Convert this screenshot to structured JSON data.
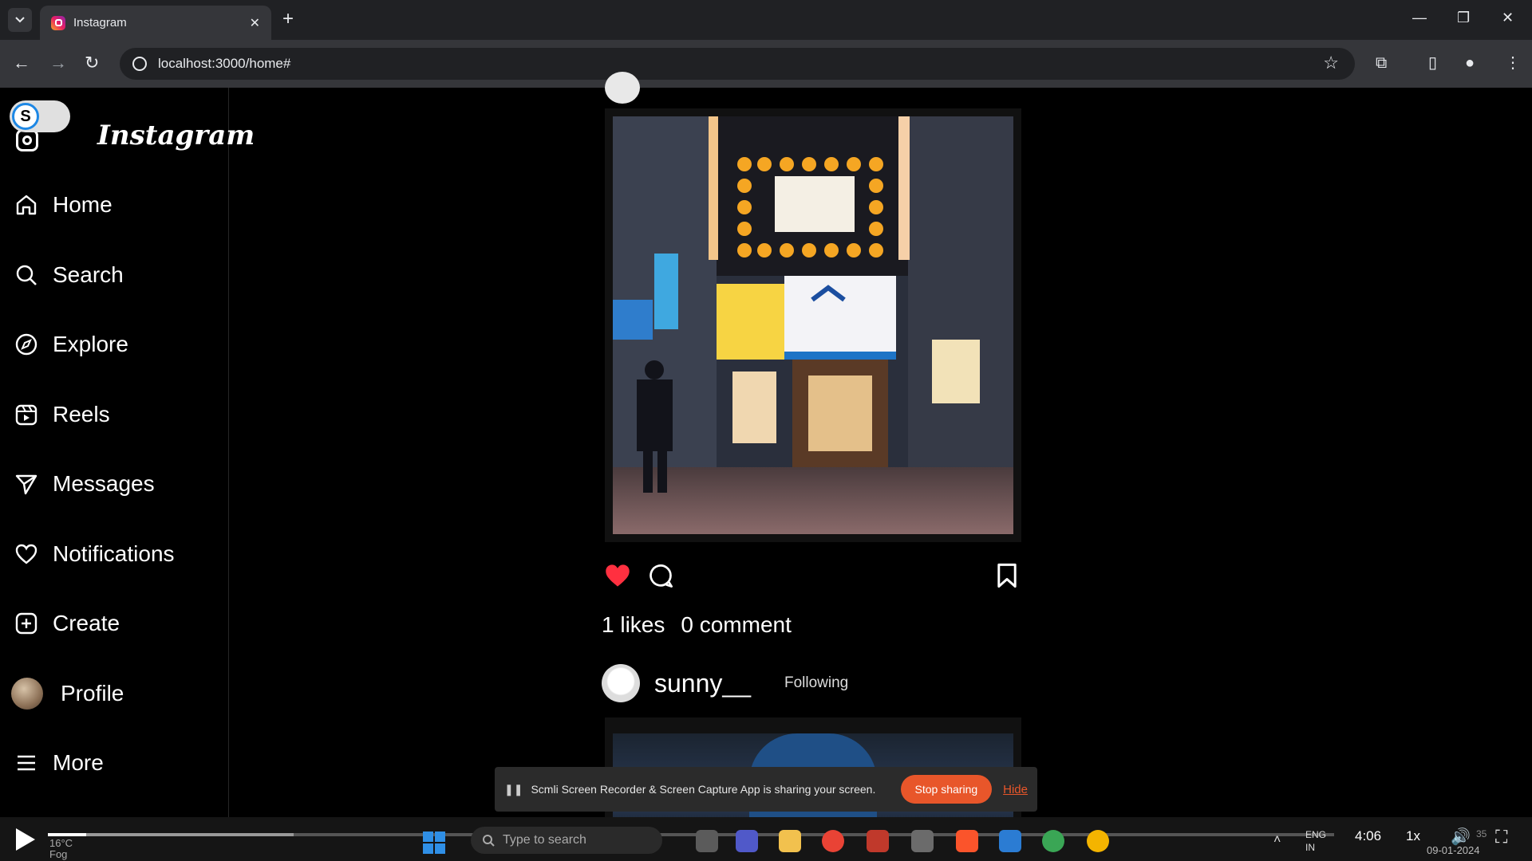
{
  "browser": {
    "tab_title": "Instagram",
    "url": "localhost:3000/home#",
    "new_tab_icon": "plus-icon",
    "close_tab_icon": "close-icon"
  },
  "sidebar": {
    "toggle_letter": "S",
    "logo_text": "Instagram",
    "items": [
      {
        "label": "Home",
        "icon": "home-icon"
      },
      {
        "label": "Search",
        "icon": "search-icon"
      },
      {
        "label": "Explore",
        "icon": "compass-icon"
      },
      {
        "label": "Reels",
        "icon": "reels-icon"
      },
      {
        "label": "Messages",
        "icon": "send-icon"
      },
      {
        "label": "Notifications",
        "icon": "heart-icon"
      },
      {
        "label": "Create",
        "icon": "plus-square-icon"
      },
      {
        "label": "Profile",
        "icon": "avatar"
      },
      {
        "label": "More",
        "icon": "menu-icon"
      }
    ]
  },
  "post": {
    "liked": true,
    "likes_text": "1 likes",
    "comments_text": "0 comment",
    "like_color": "#ff3040"
  },
  "next_post": {
    "username": "sunny__",
    "follow_status": "Following"
  },
  "share_banner": {
    "message": "Scmli Screen Recorder & Screen Capture App is sharing your screen.",
    "stop_label": "Stop sharing",
    "hide_label": "Hide",
    "accent": "#e8562a"
  },
  "player": {
    "weather_temp": "16°C",
    "weather_desc": "Fog",
    "search_placeholder": "Type to search",
    "time_elapsed": "4:06",
    "speed": "1x",
    "lang": "ENG",
    "region": "IN",
    "date": "09-01-2024",
    "clock_fragment": "35"
  }
}
